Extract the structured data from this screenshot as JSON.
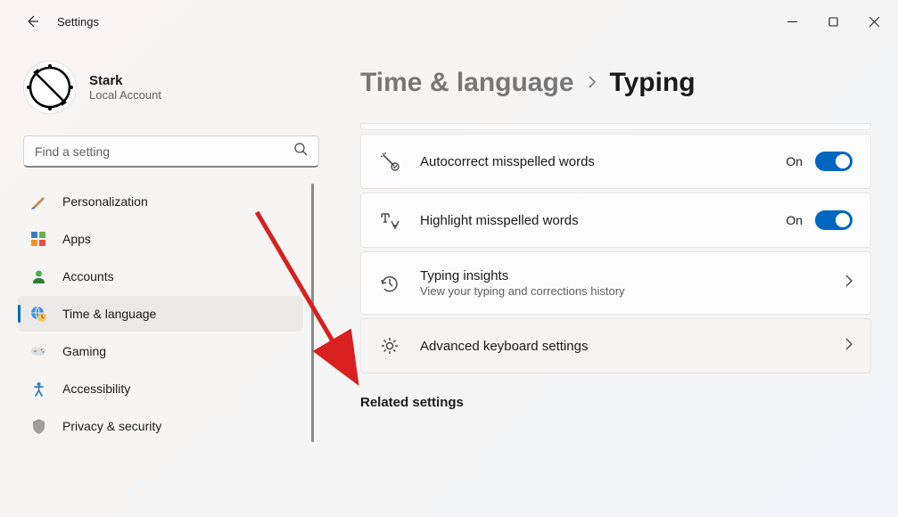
{
  "window": {
    "title": "Settings"
  },
  "profile": {
    "name": "Stark",
    "subtitle": "Local Account"
  },
  "search": {
    "placeholder": "Find a setting"
  },
  "sidebar": {
    "items": [
      {
        "label": "Personalization",
        "active": false
      },
      {
        "label": "Apps",
        "active": false
      },
      {
        "label": "Accounts",
        "active": false
      },
      {
        "label": "Time & language",
        "active": true
      },
      {
        "label": "Gaming",
        "active": false
      },
      {
        "label": "Accessibility",
        "active": false
      },
      {
        "label": "Privacy & security",
        "active": false
      }
    ]
  },
  "breadcrumb": {
    "parent": "Time & language",
    "current": "Typing"
  },
  "cards": {
    "autocorrect": {
      "title": "Autocorrect misspelled words",
      "state": "On"
    },
    "highlight": {
      "title": "Highlight misspelled words",
      "state": "On"
    },
    "insights": {
      "title": "Typing insights",
      "subtitle": "View your typing and corrections history"
    },
    "advanced": {
      "title": "Advanced keyboard settings"
    }
  },
  "section": {
    "related": "Related settings"
  }
}
